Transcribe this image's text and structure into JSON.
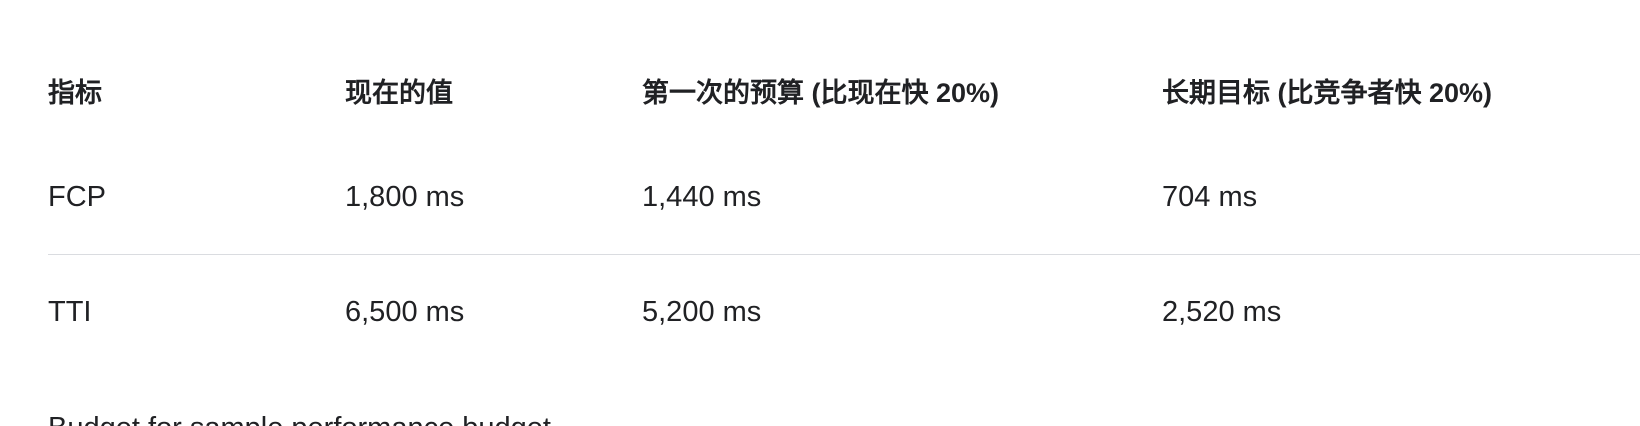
{
  "table": {
    "headers": [
      "指标",
      "现在的值",
      "第一次的预算 (比现在快 20%)",
      "长期目标 (比竞争者快 20%)"
    ],
    "rows": [
      [
        "FCP",
        "1,800 ms",
        "1,440 ms",
        "704 ms"
      ],
      [
        "TTI",
        "6,500 ms",
        "5,200 ms",
        "2,520 ms"
      ]
    ]
  },
  "footer": {
    "text": "Budget for sample performance budget"
  }
}
